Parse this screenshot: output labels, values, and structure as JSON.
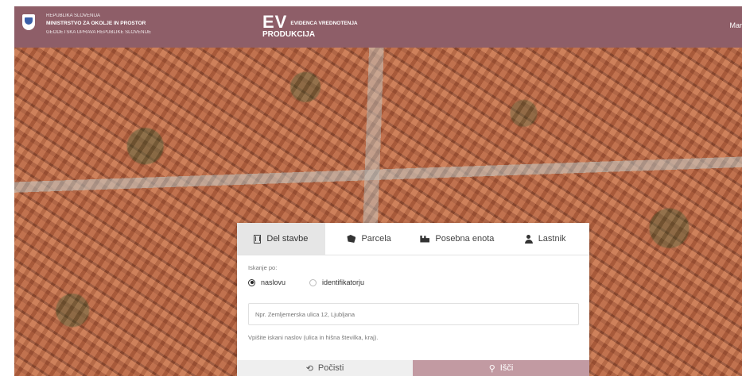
{
  "header": {
    "ministry_line1": "REPUBLIKA SLOVENIJA",
    "ministry_line2": "MINISTRSTVO ZA OKOLJE IN PROSTOR",
    "ministry_line3": "GEODETSKA UPRAVA REPUBLIKE SLOVENIJE",
    "app_short": "EV",
    "app_full": "EVIDENCA VREDNOTENJA",
    "environment": "PRODUKCIJA",
    "user_label": "Mar"
  },
  "colors": {
    "header_bg": "#8e5e68",
    "search_button": "#c29aa2",
    "active_tab": "#e6e6e6"
  },
  "search_panel": {
    "tabs": [
      {
        "label": "Del stavbe",
        "icon": "building-icon",
        "active": true
      },
      {
        "label": "Parcela",
        "icon": "parcel-icon",
        "active": false
      },
      {
        "label": "Posebna enota",
        "icon": "special-unit-icon",
        "active": false
      },
      {
        "label": "Lastnik",
        "icon": "user-icon",
        "active": false
      }
    ],
    "search_by_label": "Iskanje po:",
    "options": [
      {
        "label": "naslovu",
        "selected": true
      },
      {
        "label": "identifikatorju",
        "selected": false
      }
    ],
    "input_placeholder": "Npr. Zemljemerska ulica 12, Ljubljana",
    "input_value": "",
    "hint": "Vpišite iskani naslov (ulica in hišna številka, kraj).",
    "clear_button": "Počisti",
    "search_button": "Išči"
  }
}
